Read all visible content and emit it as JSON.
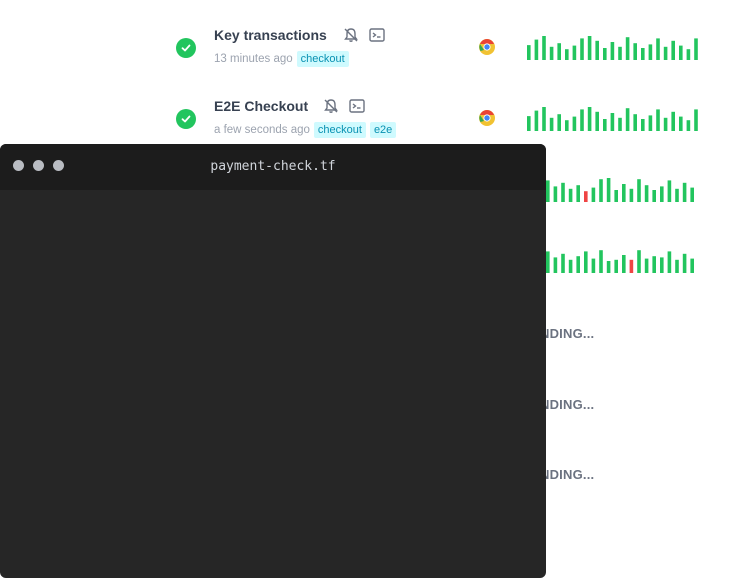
{
  "checks": [
    {
      "title": "Key transactions",
      "time": "13 minutes ago",
      "tags": [
        "checkout"
      ],
      "status": "passing",
      "bars": [
        {
          "h": 0.62
        },
        {
          "h": 0.85
        },
        {
          "h": 1.0
        },
        {
          "h": 0.55
        },
        {
          "h": 0.7
        },
        {
          "h": 0.45
        },
        {
          "h": 0.6
        },
        {
          "h": 0.9
        },
        {
          "h": 1.0
        },
        {
          "h": 0.8
        },
        {
          "h": 0.5
        },
        {
          "h": 0.75
        },
        {
          "h": 0.55
        },
        {
          "h": 0.95
        },
        {
          "h": 0.7
        },
        {
          "h": 0.5
        },
        {
          "h": 0.65
        },
        {
          "h": 0.9
        },
        {
          "h": 0.55
        },
        {
          "h": 0.8
        },
        {
          "h": 0.6
        },
        {
          "h": 0.45
        },
        {
          "h": 0.9
        }
      ],
      "failed_bar": null
    },
    {
      "title": "E2E Checkout",
      "time": "a few seconds ago",
      "tags": [
        "checkout",
        "e2e"
      ],
      "status": "passing",
      "bars": [
        {
          "h": 0.62
        },
        {
          "h": 0.85
        },
        {
          "h": 1.0
        },
        {
          "h": 0.55
        },
        {
          "h": 0.7
        },
        {
          "h": 0.45
        },
        {
          "h": 0.6
        },
        {
          "h": 0.9
        },
        {
          "h": 1.0
        },
        {
          "h": 0.8
        },
        {
          "h": 0.5
        },
        {
          "h": 0.75
        },
        {
          "h": 0.55
        },
        {
          "h": 0.95
        },
        {
          "h": 0.7
        },
        {
          "h": 0.5
        },
        {
          "h": 0.65
        },
        {
          "h": 0.9
        },
        {
          "h": 0.55
        },
        {
          "h": 0.8
        },
        {
          "h": 0.6
        },
        {
          "h": 0.45
        },
        {
          "h": 0.9
        }
      ],
      "failed_bar": null
    }
  ],
  "hidden_rows": [
    {
      "bars": [
        {
          "h": 0.9
        },
        {
          "h": 0.65
        },
        {
          "h": 0.8
        },
        {
          "h": 0.55
        },
        {
          "h": 0.7
        },
        {
          "h": 0.45
        },
        {
          "h": 0.6
        },
        {
          "h": 0.95
        },
        {
          "h": 1.0
        },
        {
          "h": 0.5
        },
        {
          "h": 0.75
        },
        {
          "h": 0.55
        },
        {
          "h": 0.95
        },
        {
          "h": 0.7
        },
        {
          "h": 0.5
        },
        {
          "h": 0.65
        },
        {
          "h": 0.9
        },
        {
          "h": 0.55
        },
        {
          "h": 0.8
        },
        {
          "h": 0.6
        }
      ],
      "failed_bar": 5
    },
    {
      "bars": [
        {
          "h": 0.9
        },
        {
          "h": 0.65
        },
        {
          "h": 0.8
        },
        {
          "h": 0.55
        },
        {
          "h": 0.7
        },
        {
          "h": 0.9
        },
        {
          "h": 0.6
        },
        {
          "h": 0.95
        },
        {
          "h": 0.5
        },
        {
          "h": 0.55
        },
        {
          "h": 0.75
        },
        {
          "h": 0.55
        },
        {
          "h": 0.95
        },
        {
          "h": 0.6
        },
        {
          "h": 0.7
        },
        {
          "h": 0.65
        },
        {
          "h": 0.9
        },
        {
          "h": 0.55
        },
        {
          "h": 0.8
        },
        {
          "h": 0.6
        }
      ],
      "failed_bar": 11
    }
  ],
  "pending_rows": [
    "NDING...",
    "NDING...",
    "NDING..."
  ],
  "terminal": {
    "title": "payment-check.tf"
  },
  "colors": {
    "pass": "#22c55e",
    "fail": "#ef4444",
    "tag_bg": "#cffafe",
    "tag_text": "#0891b2"
  }
}
